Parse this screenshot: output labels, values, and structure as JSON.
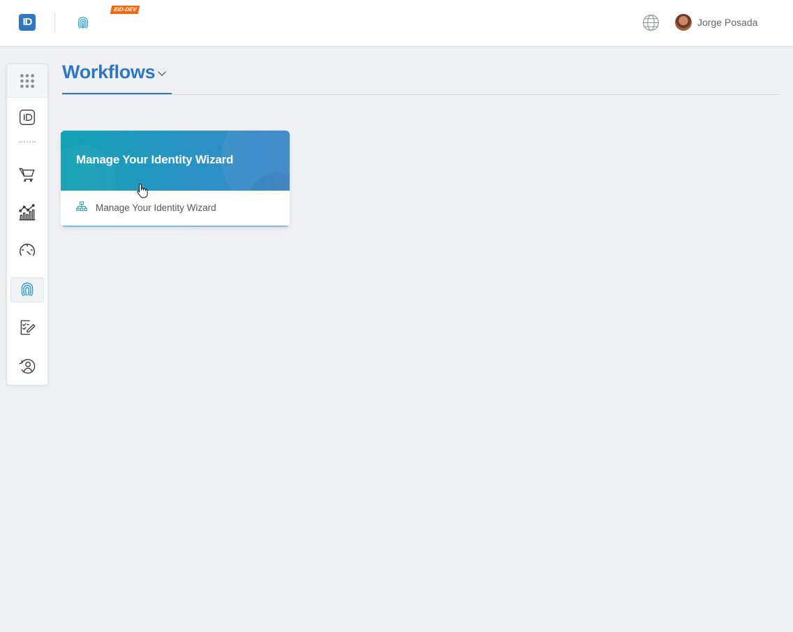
{
  "topbar": {
    "logo_text": "ID",
    "env_badge": "EID-DEV",
    "user_name": "Jorge Posada",
    "icons": [
      "id-logo-icon",
      "fingerprint-icon",
      "globe-icon",
      "avatar"
    ]
  },
  "sidebar": {
    "items": [
      {
        "name": "apps-grid-icon"
      },
      {
        "name": "id-card-icon"
      },
      {
        "name": "cart-icon"
      },
      {
        "name": "analytics-icon"
      },
      {
        "name": "gauge-icon"
      },
      {
        "name": "fingerprint-icon",
        "active": true
      },
      {
        "name": "checklist-edit-icon"
      },
      {
        "name": "user-sync-icon"
      }
    ]
  },
  "page": {
    "title": "Workflows"
  },
  "cards": [
    {
      "title": "Manage Your Identity Wizard",
      "label": "Manage Your Identity Wizard"
    }
  ],
  "colors": {
    "accent": "#2f77c2",
    "badge": "#f26a10",
    "banner_start": "#12a2b3",
    "banner_end": "#3a85c8",
    "background": "#eef0f4"
  }
}
